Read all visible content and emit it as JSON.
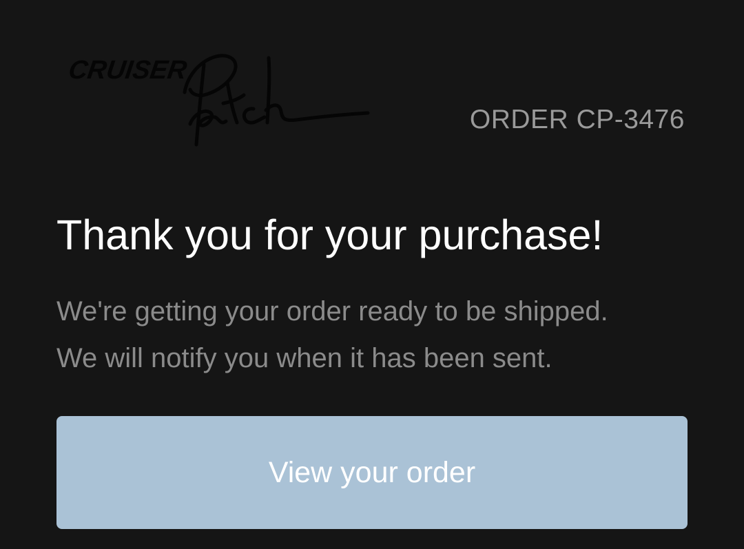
{
  "header": {
    "logo_text": "CRUISER Patch",
    "order_number": "ORDER CP-3476"
  },
  "main": {
    "headline": "Thank you for your purchase!",
    "body_lines": [
      "We're getting your order ready to be shipped.",
      "We will notify you when it has been sent."
    ],
    "view_order_label": "View your order"
  },
  "colors": {
    "background": "#151515",
    "button": "#aac2d6",
    "muted_text": "#8b8b8b"
  }
}
